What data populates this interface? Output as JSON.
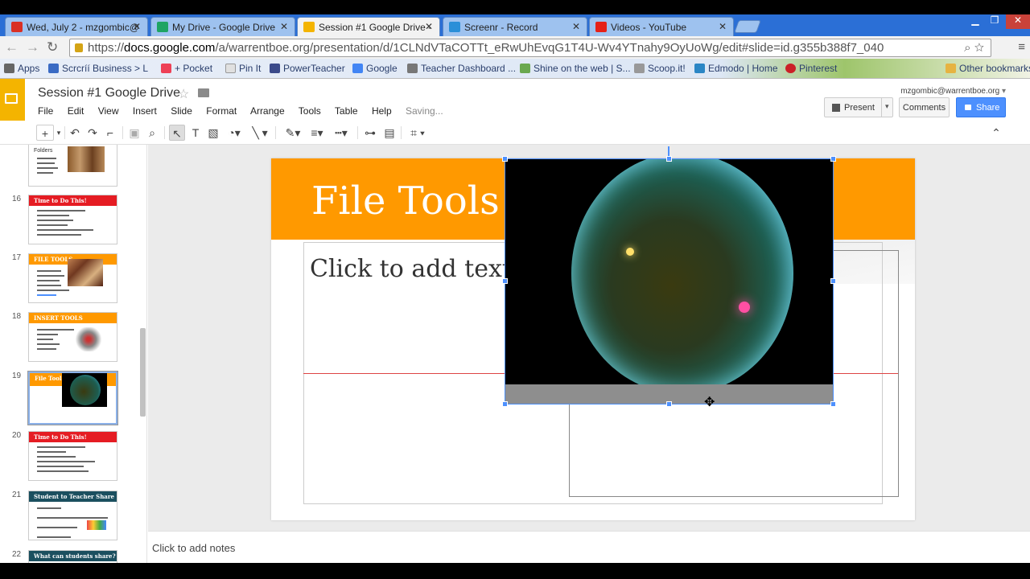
{
  "browser": {
    "tabs": [
      {
        "label": "Wed, July 2 - mzgombic@",
        "favicon_color": "#d93025"
      },
      {
        "label": "My Drive - Google Drive",
        "favicon_color": "#1fa463"
      },
      {
        "label": "Session #1 Google Drive -",
        "favicon_color": "#f4b400"
      },
      {
        "label": "Screenr - Record",
        "favicon_color": "#2a8fd8"
      },
      {
        "label": "Videos - YouTube",
        "favicon_color": "#e62117"
      }
    ],
    "url": {
      "scheme": "https://",
      "host": "docs.google.com",
      "path": "/a/warrentboe.org/presentation/d/1CLNdVTaCOTTt_eRwUhEvqG1T4U-Wv4YTnahy9OyUoWg/edit#slide=id.g355b388f7_040"
    },
    "bookmarks": [
      {
        "label": "Apps",
        "color": "#666"
      },
      {
        "label": "Scrcríí Business > L",
        "color": "#3a6bc4"
      },
      {
        "label": "+ Pocket",
        "color": "#ee4056"
      },
      {
        "label": "Pin It",
        "color": "#e0e0e0"
      },
      {
        "label": "PowerTeacher",
        "color": "#3b4a8a"
      },
      {
        "label": "Google",
        "color": "#4285f4"
      },
      {
        "label": "Teacher Dashboard ...",
        "color": "#777"
      },
      {
        "label": "Shine on the web | S...",
        "color": "#6aa84f"
      },
      {
        "label": "Scoop.it!",
        "color": "#999"
      },
      {
        "label": "Edmodo | Home",
        "color": "#2b86c5"
      },
      {
        "label": "Pinterest",
        "color": "#cb2027"
      },
      {
        "label": "Other bookmarks",
        "color": "#e6b341"
      }
    ]
  },
  "docs": {
    "title": "Session #1 Google Drive",
    "menu": [
      "File",
      "Edit",
      "View",
      "Insert",
      "Slide",
      "Format",
      "Arrange",
      "Tools",
      "Table",
      "Help"
    ],
    "status": "Saving...",
    "user_email": "mzgombic@warrentboe.org",
    "present_label": "Present",
    "comments_label": "Comments",
    "share_label": "Share"
  },
  "filmstrip": [
    {
      "num": "",
      "title": "",
      "color": "#ffffff",
      "extra": "Folders"
    },
    {
      "num": "16",
      "title": "Time to Do This!",
      "color": "#e51c23"
    },
    {
      "num": "17",
      "title": "FILE TOOLS",
      "color": "#ff9900"
    },
    {
      "num": "18",
      "title": "INSERT TOOLS",
      "color": "#ff9900"
    },
    {
      "num": "19",
      "title": "File Tools",
      "color": "#ff9900"
    },
    {
      "num": "20",
      "title": "Time to Do This!",
      "color": "#e51c23"
    },
    {
      "num": "21",
      "title": "Student to Teacher Share",
      "color": "#1b4f5f"
    },
    {
      "num": "22",
      "title": "What can students share?",
      "color": "#1b4f5f"
    }
  ],
  "slide": {
    "title": "File Tools",
    "placeholder": "Click to add text",
    "accent_color": "#ff9900"
  },
  "notes_placeholder": "Click to add notes"
}
